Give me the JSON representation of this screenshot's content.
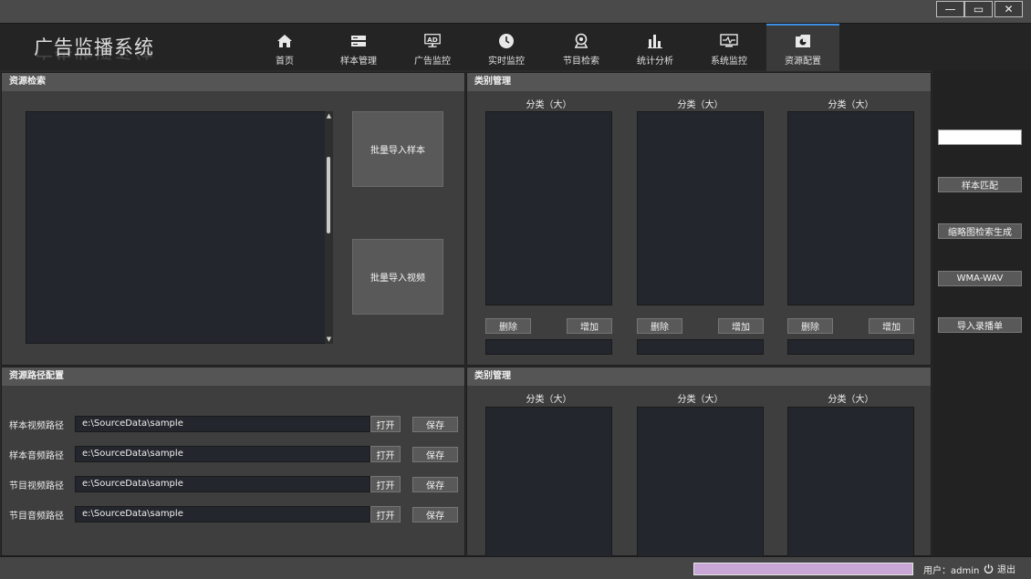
{
  "window": {
    "minimize_glyph": "—",
    "maximize_glyph": "▭",
    "close_glyph": "✕"
  },
  "app": {
    "title": "广告监播系统"
  },
  "nav": {
    "items": [
      {
        "label": "首页",
        "icon": "home-icon"
      },
      {
        "label": "样本管理",
        "icon": "sample-icon"
      },
      {
        "label": "广告监控",
        "icon": "ad-icon"
      },
      {
        "label": "实时监控",
        "icon": "clock-icon"
      },
      {
        "label": "节目检索",
        "icon": "search-icon"
      },
      {
        "label": "统计分析",
        "icon": "bar-chart-icon"
      },
      {
        "label": "系统监控",
        "icon": "monitor-icon"
      },
      {
        "label": "资源配置",
        "icon": "config-icon"
      }
    ],
    "active_index": 7,
    "ad_icon_text": "AD"
  },
  "resource_search": {
    "title": "资源检索",
    "batch_import_sample": "批量导入样本",
    "batch_import_video": "批量导入视频"
  },
  "category_top": {
    "title": "类别管理",
    "columns": [
      {
        "label": "分类（大）",
        "delete": "删除",
        "add": "增加"
      },
      {
        "label": "分类（大）",
        "delete": "删除",
        "add": "增加"
      },
      {
        "label": "分类（大）",
        "delete": "删除",
        "add": "增加"
      }
    ]
  },
  "category_bottom": {
    "title": "类别管理",
    "columns": [
      {
        "label": "分类（大）"
      },
      {
        "label": "分类（大）"
      },
      {
        "label": "分类（大）"
      }
    ]
  },
  "path_config": {
    "title": "资源路径配置",
    "rows": [
      {
        "label": "样本视频路径",
        "value": "e:\\SourceData\\sample",
        "open": "打开",
        "save": "保存"
      },
      {
        "label": "样本音频路径",
        "value": "e:\\SourceData\\sample",
        "open": "打开",
        "save": "保存"
      },
      {
        "label": "节目视频路径",
        "value": "e:\\SourceData\\sample",
        "open": "打开",
        "save": "保存"
      },
      {
        "label": "节目音频路径",
        "value": "e:\\SourceData\\sample",
        "open": "打开",
        "save": "保存"
      }
    ]
  },
  "side_actions": {
    "sample_match": "样本匹配",
    "thumbnail_search": "缩略图检索生成",
    "wma_wav": "WMA-WAV",
    "import_schedule": "导入录播单"
  },
  "status": {
    "user_label": "用户：admin",
    "logout": "退出",
    "progress": 1.0,
    "progress_color": "#c8a6d6"
  },
  "colors": {
    "accent": "#3d8ee0",
    "panel_header": "#555555",
    "list_bg": "#23262c"
  }
}
